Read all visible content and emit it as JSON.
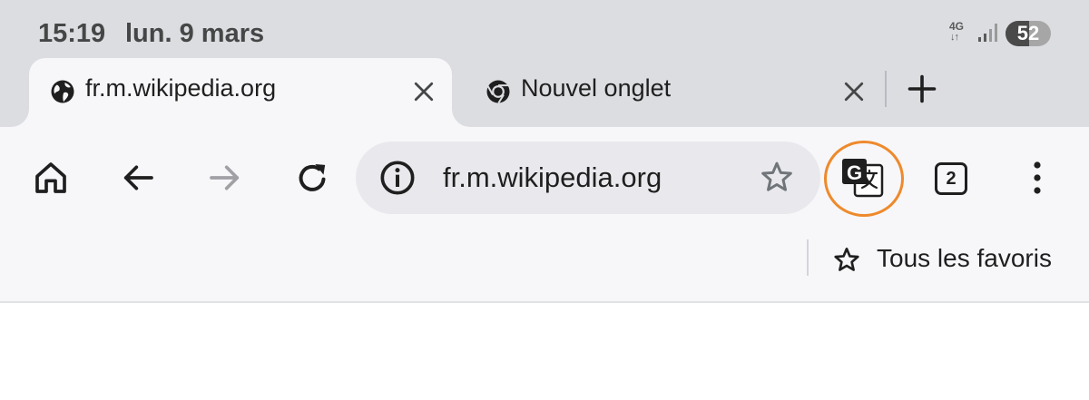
{
  "status_bar": {
    "time": "15:19",
    "date": "lun. 9 mars",
    "network": "4G",
    "network_arrows": "↓↑",
    "battery": "52",
    "battery_level_percent": 52
  },
  "tabs": [
    {
      "label": "fr.m.wikipedia.org",
      "icon": "globe-icon",
      "active": true
    },
    {
      "label": "Nouvel onglet",
      "icon": "chrome-icon",
      "active": false
    }
  ],
  "toolbar": {
    "url": "fr.m.wikipedia.org",
    "tab_count": "2",
    "icons": [
      "home-icon",
      "back-arrow-icon",
      "forward-arrow-icon",
      "reload-icon",
      "site-info-icon",
      "bookmark-star-icon",
      "google-translate-icon",
      "tab-switcher-icon",
      "more-menu-icon"
    ]
  },
  "bookmarks_bar": {
    "all_bookmarks_label": "Tous les favoris"
  },
  "colors": {
    "tab_strip": "#dcdde1",
    "toolbar": "#f7f7fa",
    "omnibox": "#e9e9ed",
    "annotation_circle": "#ee8a2c",
    "disabled_icon": "#a0a0a5"
  }
}
